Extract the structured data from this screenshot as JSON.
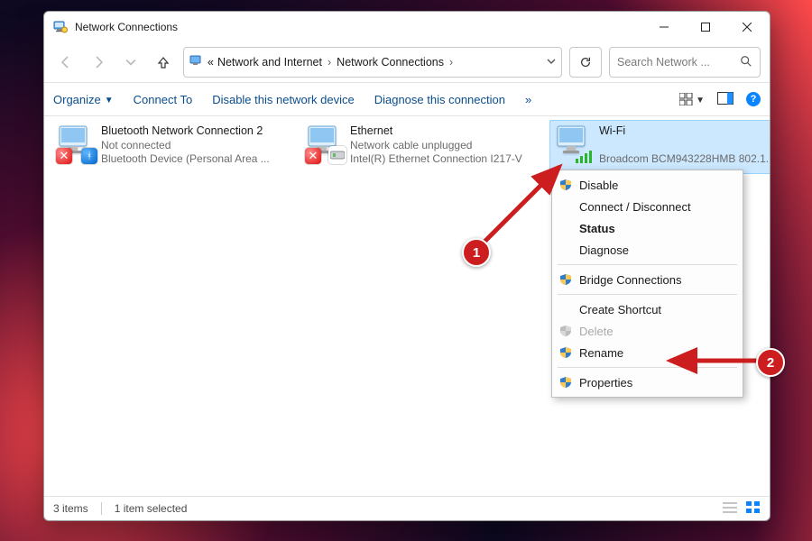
{
  "window": {
    "title": "Network Connections"
  },
  "breadcrumb": {
    "prefix": "«",
    "parts": [
      "Network and Internet",
      "Network Connections"
    ]
  },
  "search": {
    "placeholder": "Search Network ..."
  },
  "toolbar": {
    "organize": "Organize",
    "connect_to": "Connect To",
    "disable_device": "Disable this network device",
    "diagnose": "Diagnose this connection",
    "more": "»"
  },
  "adapters": [
    {
      "name": "Bluetooth Network Connection 2",
      "status": "Not connected",
      "device": "Bluetooth Device (Personal Area ...",
      "kind": "bluetooth-disabled",
      "selected": false
    },
    {
      "name": "Ethernet",
      "status": "Network cable unplugged",
      "device": "Intel(R) Ethernet Connection I217-V",
      "kind": "ethernet-disabled",
      "selected": false
    },
    {
      "name": "Wi-Fi",
      "status": "",
      "device": "Broadcom BCM943228HMB 802.1...",
      "kind": "wifi",
      "selected": true
    }
  ],
  "context_menu": [
    {
      "label": "Disable",
      "shield": true
    },
    {
      "label": "Connect / Disconnect"
    },
    {
      "label": "Status",
      "bold": true
    },
    {
      "label": "Diagnose"
    },
    {
      "separator": true
    },
    {
      "label": "Bridge Connections",
      "shield": true
    },
    {
      "separator": true
    },
    {
      "label": "Create Shortcut"
    },
    {
      "label": "Delete",
      "shield": true,
      "disabled": true
    },
    {
      "label": "Rename",
      "shield": true
    },
    {
      "separator": true
    },
    {
      "label": "Properties",
      "shield": true
    }
  ],
  "statusbar": {
    "items": "3 items",
    "selected": "1 item selected"
  },
  "callouts": {
    "one": "1",
    "two": "2"
  }
}
